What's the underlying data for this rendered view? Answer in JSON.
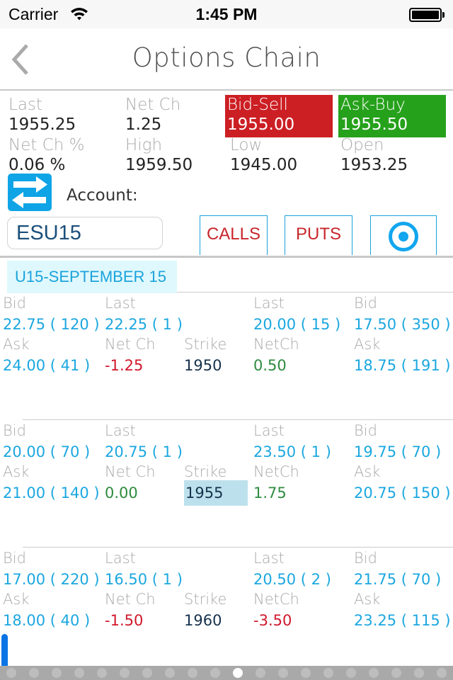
{
  "status_bar": {
    "carrier": "Carrier",
    "time": "1:45 PM",
    "battery_level": 1.0
  },
  "nav": {
    "title": "Options Chain",
    "back_icon": "chevron-left-icon"
  },
  "quote": {
    "last": {
      "label": "Last",
      "value": "1955.25"
    },
    "net_ch": {
      "label": "Net Ch",
      "value": "1.25"
    },
    "net_ch_pct": {
      "label": "Net Ch %",
      "value": "0.06 %"
    },
    "high": {
      "label": "High",
      "value": "1959.50"
    },
    "low": {
      "label": "Low",
      "value": "1945.00"
    },
    "open": {
      "label": "Open",
      "value": "1953.25"
    },
    "bid_sell": {
      "label": "Bid-Sell",
      "value": "1955.00",
      "color": "#cc1f24"
    },
    "ask_buy": {
      "label": "Ask-Buy",
      "value": "1955.50",
      "color": "#26a11b"
    }
  },
  "account": {
    "label": "Account:",
    "swap_icon": "swap-arrows-icon",
    "symbol": "ESU15"
  },
  "tabs": {
    "calls": "CALLS",
    "puts": "PUTS",
    "both_icon": "radio-selected-icon"
  },
  "expiry": "U15-SEPTEMBER 15",
  "labels": {
    "bid": "Bid",
    "last": "Last",
    "ask": "Ask",
    "net_ch": "Net Ch",
    "strike": "Strike",
    "netch": "NetCh"
  },
  "rows": [
    {
      "call_bid": "22.75 ( 120 )",
      "call_last": "22.25 ( 1 )",
      "call_ask": "24.00 ( 41 )",
      "call_netch": "-1.25",
      "call_netch_sign": "neg",
      "strike": "1950",
      "strike_highlight": false,
      "put_last": "20.00 ( 15 )",
      "put_bid": "17.50 ( 350 )",
      "put_netch": "0.50",
      "put_netch_sign": "pos",
      "put_ask": "18.75 ( 191 )"
    },
    {
      "call_bid": "20.00 ( 70 )",
      "call_last": "20.75 ( 1 )",
      "call_ask": "21.00 ( 140 )",
      "call_netch": "0.00",
      "call_netch_sign": "neu",
      "strike": "1955",
      "strike_highlight": true,
      "put_last": "23.50 ( 1 )",
      "put_bid": "19.75 ( 70 )",
      "put_netch": "1.75",
      "put_netch_sign": "pos",
      "put_ask": "20.75 ( 150 )"
    },
    {
      "call_bid": "17.00 ( 220 )",
      "call_last": "16.50 ( 1 )",
      "call_ask": "18.00 ( 40 )",
      "call_netch": "-1.50",
      "call_netch_sign": "neg",
      "strike": "1960",
      "strike_highlight": false,
      "put_last": "20.50 ( 2 )",
      "put_bid": "21.75 ( 70 )",
      "put_netch": "-3.50",
      "put_netch_sign": "neg",
      "put_ask": "23.25 ( 115 )"
    }
  ],
  "pager": {
    "total_pages": 20,
    "current_page": 11
  },
  "colors": {
    "accent": "#1ba7e0",
    "positive": "#2e8b3e",
    "negative": "#d0182c",
    "tab_text": "#c7262b"
  }
}
